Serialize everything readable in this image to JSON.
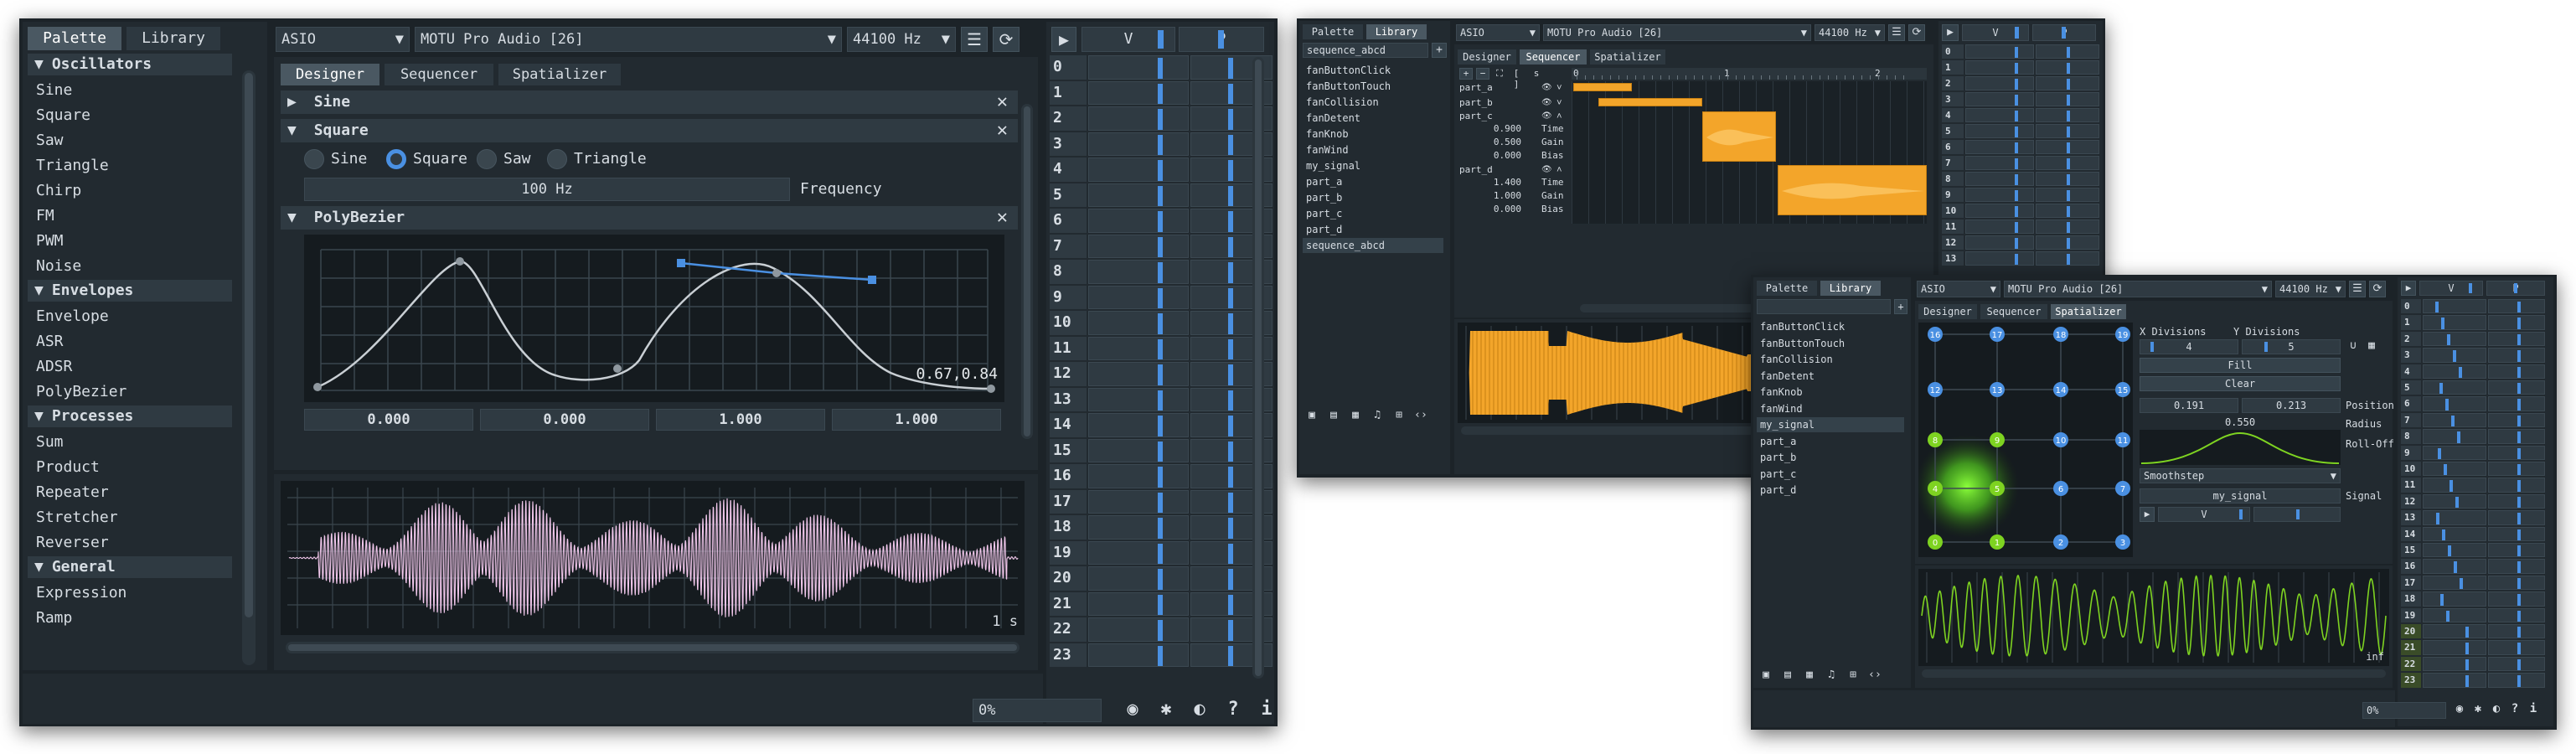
{
  "w1": {
    "sidebar_tabs": [
      "Palette",
      "Library"
    ],
    "sections": [
      {
        "title": "Oscillators",
        "items": [
          "Sine",
          "Square",
          "Saw",
          "Triangle",
          "Chirp",
          "FM",
          "PWM",
          "Noise"
        ]
      },
      {
        "title": "Envelopes",
        "items": [
          "Envelope",
          "ASR",
          "ADSR",
          "PolyBezier"
        ]
      },
      {
        "title": "Processes",
        "items": [
          "Sum",
          "Product",
          "Repeater",
          "Stretcher",
          "Reverser"
        ]
      },
      {
        "title": "General",
        "items": [
          "Expression",
          "Ramp"
        ]
      }
    ],
    "driver": "ASIO",
    "device": "MOTU Pro Audio [26]",
    "rate": "44100 Hz",
    "tabs": [
      "Designer",
      "Sequencer",
      "Spatializer"
    ],
    "nodes": {
      "sine": "Sine",
      "square": "Square",
      "polybezier": "PolyBezier"
    },
    "wave_options": [
      "Sine",
      "Square",
      "Saw",
      "Triangle"
    ],
    "wave_selected": "Square",
    "freq_value": "100 Hz",
    "freq_label": "Frequency",
    "bezier_readout": "0.67,0.84",
    "bezier_values": [
      "0.000",
      "0.000",
      "1.000",
      "1.000"
    ],
    "plot_time": "1 s",
    "status_value": "0%",
    "mixer_header": [
      "V",
      "P"
    ],
    "channels": [
      "0",
      "1",
      "2",
      "3",
      "4",
      "5",
      "6",
      "7",
      "8",
      "9",
      "10",
      "11",
      "12",
      "13",
      "14",
      "15",
      "16",
      "17",
      "18",
      "19",
      "20",
      "21",
      "22",
      "23"
    ]
  },
  "w2": {
    "sidebar_tabs": [
      "Palette",
      "Library"
    ],
    "search_value": "sequence_abcd",
    "library": [
      "fanButtonClick",
      "fanButtonTouch",
      "fanCollision",
      "fanDetent",
      "fanKnob",
      "fanWind",
      "my_signal",
      "part_a",
      "part_b",
      "part_c",
      "part_d",
      "sequence_abcd"
    ],
    "selected": "sequence_abcd",
    "driver": "ASIO",
    "device": "MOTU Pro Audio [26]",
    "rate": "44100 Hz",
    "tabs": [
      "Designer",
      "Sequencer",
      "Spatializer"
    ],
    "toolbar_text": "s",
    "ruler": [
      "0",
      "1",
      "2"
    ],
    "tracks": [
      "part_a",
      "part_b",
      "part_c",
      "part_d"
    ],
    "part_c_params": [
      [
        "0.900",
        "Time"
      ],
      [
        "0.500",
        "Gain"
      ],
      [
        "0.000",
        "Bias"
      ]
    ],
    "part_d_params": [
      [
        "1.400",
        "Time"
      ],
      [
        "1.000",
        "Gain"
      ],
      [
        "0.000",
        "Bias"
      ]
    ],
    "mixer_header": [
      "V",
      "P"
    ],
    "channels": [
      "0",
      "1",
      "2",
      "3",
      "4",
      "5",
      "6",
      "7",
      "8",
      "9",
      "10",
      "11",
      "12",
      "13"
    ]
  },
  "w3": {
    "sidebar_tabs": [
      "Palette",
      "Library"
    ],
    "library": [
      "fanButtonClick",
      "fanButtonTouch",
      "fanCollision",
      "fanDetent",
      "fanKnob",
      "fanWind",
      "my_signal",
      "part_a",
      "part_b",
      "part_c",
      "part_d"
    ],
    "selected": "my_signal",
    "driver": "ASIO",
    "device": "MOTU Pro Audio [26]",
    "rate": "44100 Hz",
    "tabs": [
      "Designer",
      "Sequencer",
      "Spatializer"
    ],
    "grid_labels": [
      "16",
      "17",
      "18",
      "19",
      "12",
      "13",
      "14",
      "15",
      "8",
      "9",
      "10",
      "11",
      "4",
      "5",
      "6",
      "7",
      "0",
      "1",
      "2",
      "3"
    ],
    "x_div_label": "X Divisions",
    "y_div_label": "Y Divisions",
    "x_div": "4",
    "y_div": "5",
    "fill_label": "Fill",
    "clear_label": "Clear",
    "pos_x": "0.191",
    "pos_y": "0.213",
    "position_label": "Position",
    "radius": "0.550",
    "radius_label": "Radius",
    "rolloff_label": "Roll-Off",
    "rolloff_value": "Smoothstep",
    "signal_value": "my_signal",
    "signal_label": "Signal",
    "play_v": "V",
    "plot_time": "inf",
    "status_value": "0%",
    "mixer_header": [
      "V",
      "P"
    ],
    "channels": [
      "0",
      "1",
      "2",
      "3",
      "4",
      "5",
      "6",
      "7",
      "8",
      "9",
      "10",
      "11",
      "12",
      "13",
      "14",
      "15",
      "16",
      "17",
      "18",
      "19",
      "20",
      "21",
      "22",
      "23"
    ]
  },
  "colors": {
    "accent": "#4a90e2",
    "orange": "#f3a52a",
    "green": "#7ed321",
    "pink": "#f2c8ec"
  }
}
